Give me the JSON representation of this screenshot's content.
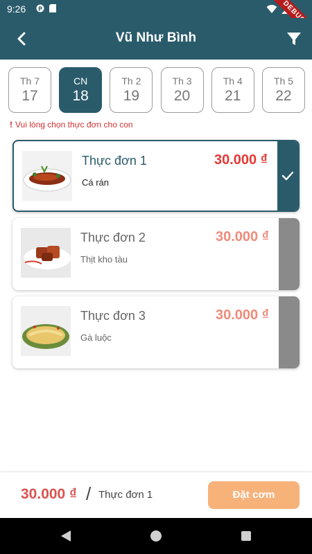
{
  "status_bar": {
    "time": "9:26",
    "debug_label": "DEBUG"
  },
  "app_bar": {
    "title": "Vũ Như Bình"
  },
  "days": [
    {
      "name": "Th 7",
      "num": "17"
    },
    {
      "name": "CN",
      "num": "18"
    },
    {
      "name": "Th 2",
      "num": "19"
    },
    {
      "name": "Th 3",
      "num": "20"
    },
    {
      "name": "Th 4",
      "num": "21"
    },
    {
      "name": "Th 5",
      "num": "22"
    }
  ],
  "selected_day_index": 1,
  "warning": {
    "mark": "!",
    "text": "Vui lòng chọn thực đơn cho con"
  },
  "menus": [
    {
      "name": "Thực đơn 1",
      "desc": "Cá rán",
      "price": "30.000 ₫",
      "selected": true,
      "image": "fried-fish-photo"
    },
    {
      "name": "Thực đơn 2",
      "desc": "Thịt kho tàu",
      "price": "30.000 ₫",
      "selected": false,
      "image": "braised-pork-photo"
    },
    {
      "name": "Thực đơn 3",
      "desc": "Gà luộc",
      "price": "30.000 ₫",
      "selected": false,
      "image": "boiled-chicken-photo"
    }
  ],
  "bottom": {
    "total": "30.000 ₫",
    "separator": "/",
    "selected_menu": "Thực đơn 1",
    "order_button": "Đặt cơm"
  },
  "colors": {
    "primary": "#2a5b6b",
    "price_selected": "#e53935",
    "price": "#ef8a7a",
    "order_button": "#f7b27a",
    "warning": "#d32f2f"
  }
}
